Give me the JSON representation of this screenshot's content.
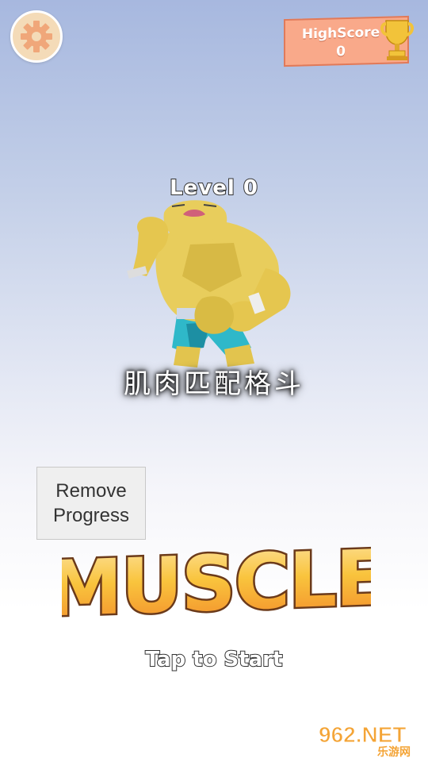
{
  "header": {
    "settings_icon": "gear-icon",
    "highscore_label": "HighScore",
    "highscore_value": "0",
    "trophy_icon": "trophy-icon"
  },
  "level": {
    "label": "Level 0"
  },
  "character": {
    "name": "muscle-fighter"
  },
  "title_cn": "肌肉匹配格斗",
  "remove_progress": {
    "label": "Remove\nProgress"
  },
  "logo": {
    "text": "MUSCLE"
  },
  "start": {
    "label": "Tap to Start"
  },
  "watermark": {
    "main": "962.NET",
    "sub": "乐游网"
  },
  "colors": {
    "accent_orange": "#f9a98a",
    "logo_fill": "#f7b733",
    "logo_stroke": "#6b3a1a",
    "settings_bg": "#f4dbb8"
  }
}
